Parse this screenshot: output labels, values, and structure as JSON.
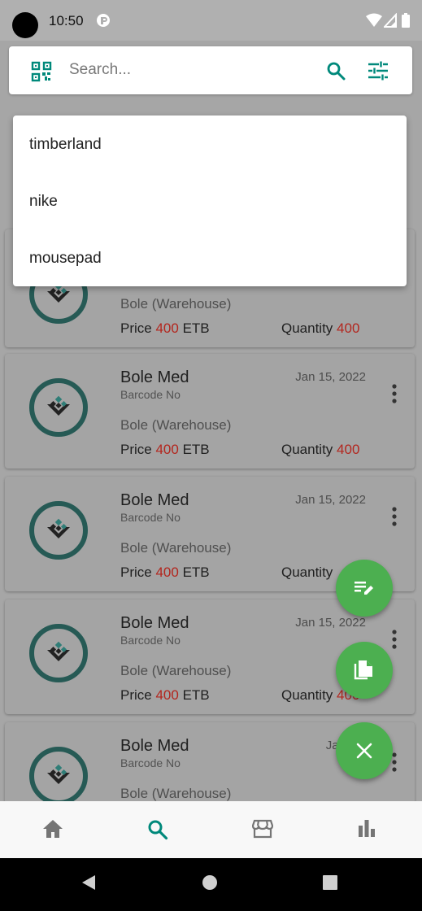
{
  "status_bar": {
    "time": "10:50",
    "icons": [
      "camera-cutout",
      "notification-app-icon",
      "wifi-icon",
      "signal-icon",
      "battery-icon"
    ]
  },
  "search": {
    "placeholder": "Search...",
    "value": "",
    "icons": [
      "qr-scan-icon",
      "search-icon",
      "filter-icon"
    ],
    "accent": "#00897b"
  },
  "suggestions": [
    "timberland",
    "nike",
    "mousepad"
  ],
  "products": [
    {
      "name": "",
      "barcode": "",
      "date": "",
      "location": "Bole (Warehouse)",
      "price_label": "Price",
      "price": "400",
      "currency": "ETB",
      "quantity_label": "Quantity",
      "quantity": "400"
    },
    {
      "name": "Bole Med",
      "barcode": "Barcode No",
      "date": "Jan 15, 2022",
      "location": "Bole (Warehouse)",
      "price_label": "Price",
      "price": "400",
      "currency": "ETB",
      "quantity_label": "Quantity",
      "quantity": "400"
    },
    {
      "name": "Bole Med",
      "barcode": "Barcode No",
      "date": "Jan 15, 2022",
      "location": "Bole (Warehouse)",
      "price_label": "Price",
      "price": "400",
      "currency": "ETB",
      "quantity_label": "Quantity",
      "quantity": ""
    },
    {
      "name": "Bole Med",
      "barcode": "Barcode No",
      "date": "Jan 15, 2022",
      "location": "Bole (Warehouse)",
      "price_label": "Price",
      "price": "400",
      "currency": "ETB",
      "quantity_label": "Quantity",
      "quantity": "400"
    },
    {
      "name": "Bole Med",
      "barcode": "Barcode No",
      "date": "Jan 15,",
      "location": "Bole (Warehouse)",
      "price_label": "",
      "price": "",
      "currency": "",
      "quantity_label": "",
      "quantity": ""
    }
  ],
  "fabs": [
    "edit-note-icon",
    "copy-icon",
    "close-icon"
  ],
  "bottom_nav": {
    "items": [
      "home-icon",
      "search-icon",
      "store-icon",
      "bar-chart-icon"
    ],
    "active": "search-icon"
  },
  "system_nav": [
    "back-icon",
    "home-circle-icon",
    "recents-icon"
  ],
  "colors": {
    "accent": "#00897b",
    "fab": "#4caf50",
    "value_red": "#b3261e",
    "logo_ring": "#265a55",
    "scrim": "#a6a6a6"
  }
}
